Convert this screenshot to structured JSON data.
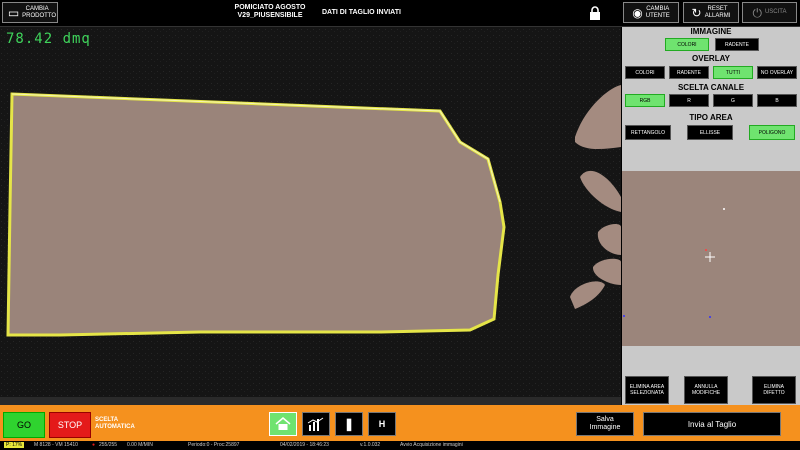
{
  "topbar": {
    "change_product": "CAMBIA PRODOTTO",
    "product_line1": "POMICIATO AGOSTO",
    "product_line2": "V29_PIUSENSIBILE",
    "cut_status": "DATI DI TAGLIO INVIATI",
    "change_user": "CAMBIA UTENTE",
    "reset_alarms": "RESET ALLARMI",
    "exit": "USCITA"
  },
  "viewer": {
    "area_readout": "78.42 dmq"
  },
  "panel": {
    "image": {
      "title": "IMMAGINE",
      "options": [
        "COLORI",
        "RADENTE"
      ],
      "selected": "COLORI"
    },
    "overlay": {
      "title": "OVERLAY",
      "options": [
        "COLORI",
        "RADENTE",
        "TUTTI",
        "NO OVERLAY"
      ],
      "selected": "TUTTI"
    },
    "channel": {
      "title": "SCELTA CANALE",
      "options": [
        "RGB",
        "R",
        "G",
        "B"
      ],
      "selected": "RGB"
    },
    "area_type": {
      "title": "TIPO AREA",
      "options": [
        "RETTANGOLO",
        "ELLISSE",
        "POLIGONO"
      ],
      "selected": "POLIGONO"
    },
    "actions": {
      "delete_area": "ELIMINA AREA SELEZIONATA",
      "undo_changes": "ANNULLA MODIFICHE",
      "delete_defect": "ELIMINA DIFETTO"
    }
  },
  "bottom": {
    "go": "GO",
    "stop": "STOP",
    "auto_line1": "SCELTA",
    "auto_line2": "AUTOMATICA",
    "h_button": "H",
    "save_line1": "Salva",
    "save_line2": "Immagine",
    "send": "Invia al Taglio"
  },
  "statusbar": {
    "percent": "17%",
    "machine": "M 8128 - VM 15410",
    "counts": "255/255",
    "speed": "0.00 M/MIN",
    "period": "Periodo:0 - Proc:25897",
    "datetime": "04/02/2019 - 18:46:23",
    "version": "v.1.0.032",
    "message": "Avvio Acquisizione immagini"
  },
  "colors": {
    "accent_green": "#6fe36f",
    "bottom_bar": "#f5911e",
    "stop_red": "#e41a1a",
    "panel_gray": "#c9c9c9"
  }
}
